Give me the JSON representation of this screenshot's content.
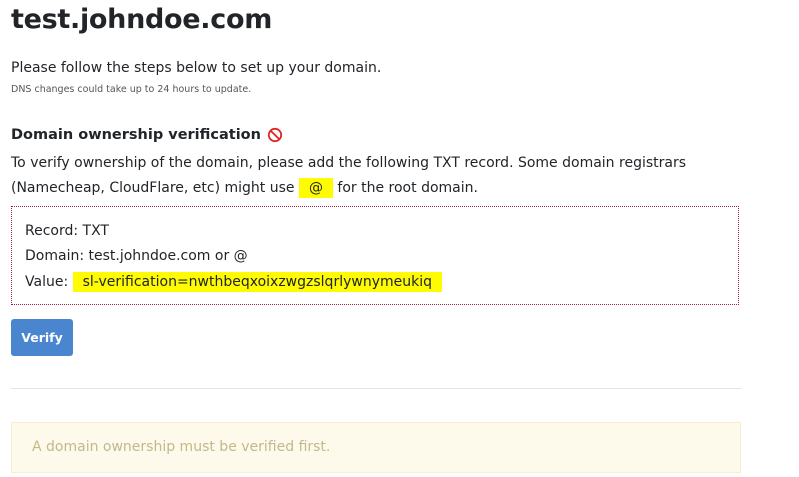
{
  "header": {
    "title": "test.johndoe.com"
  },
  "intro": {
    "text": "Please follow the steps below to set up your domain.",
    "note": "DNS changes could take up to 24 hours to update."
  },
  "verification": {
    "title": "Domain ownership verification",
    "status_icon": "prohibited-icon",
    "status_color": "#e02424",
    "description_before": "To verify ownership of the domain, please add the following TXT record. Some domain registrars (Namecheap, CloudFlare, etc) might use ",
    "root_symbol": "@",
    "description_after": " for the root domain.",
    "highlight_color": "#fffb00"
  },
  "record": {
    "type_line": "Record: TXT",
    "domain_line": "Domain: test.johndoe.com or @",
    "value_label": "Value: ",
    "value": "sl-verification=nwthbeqxoixzwgzslqrlywnymeukiq",
    "border_color": "#a01e48"
  },
  "actions": {
    "verify_label": "Verify",
    "verify_color": "#4a86cf"
  },
  "notice": {
    "text": "A domain ownership must be verified first."
  }
}
